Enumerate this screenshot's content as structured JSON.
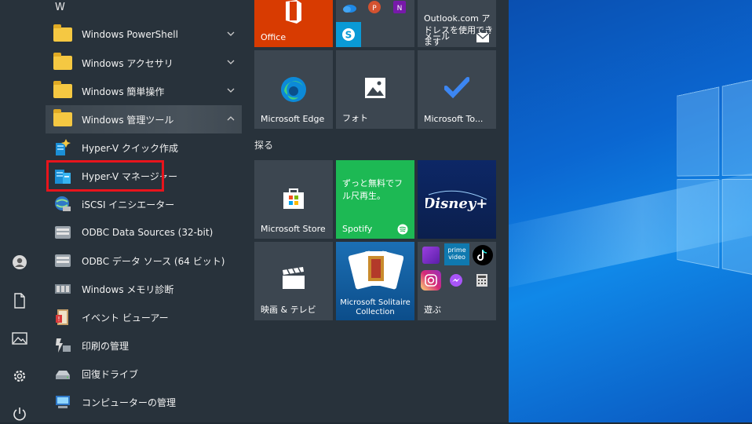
{
  "app_list": {
    "letter": "W",
    "items": [
      {
        "label": "Windows PowerShell",
        "type": "folder",
        "expanded": false
      },
      {
        "label": "Windows アクセサリ",
        "type": "folder",
        "expanded": false
      },
      {
        "label": "Windows 簡単操作",
        "type": "folder",
        "expanded": false
      },
      {
        "label": "Windows 管理ツール",
        "type": "folder",
        "expanded": true
      },
      {
        "label": "Hyper-V クイック作成",
        "type": "app"
      },
      {
        "label": "Hyper-V マネージャー",
        "type": "app"
      },
      {
        "label": "iSCSI イニシエーター",
        "type": "app"
      },
      {
        "label": "ODBC Data Sources (32-bit)",
        "type": "app"
      },
      {
        "label": "ODBC データ ソース (64 ビット)",
        "type": "app"
      },
      {
        "label": "Windows メモリ診断",
        "type": "app"
      },
      {
        "label": "イベント ビューアー",
        "type": "app"
      },
      {
        "label": "印刷の管理",
        "type": "app"
      },
      {
        "label": "回復ドライブ",
        "type": "app"
      },
      {
        "label": "コンピューターの管理",
        "type": "app"
      }
    ]
  },
  "tiles": {
    "office": "Office",
    "mail_text": "Outlook.com アドレスを使用できます",
    "mail_label": "メール",
    "edge": "Microsoft Edge",
    "photos": "フォト",
    "todo": "Microsoft To...",
    "group_explore": "探る",
    "store": "Microsoft Store",
    "spotify_text": "ずっと無料でフル尺再生。",
    "spotify": "Spotify",
    "disney": "Disney+",
    "movies": "映画 & テレビ",
    "solitaire": "Microsoft Solitaire Collection",
    "play": "遊ぶ",
    "prime": "prime video"
  },
  "colors": {
    "highlight": "#e8141c",
    "office": "#d83b01",
    "spotify": "#1db954",
    "disney": "#0b1f4d"
  }
}
